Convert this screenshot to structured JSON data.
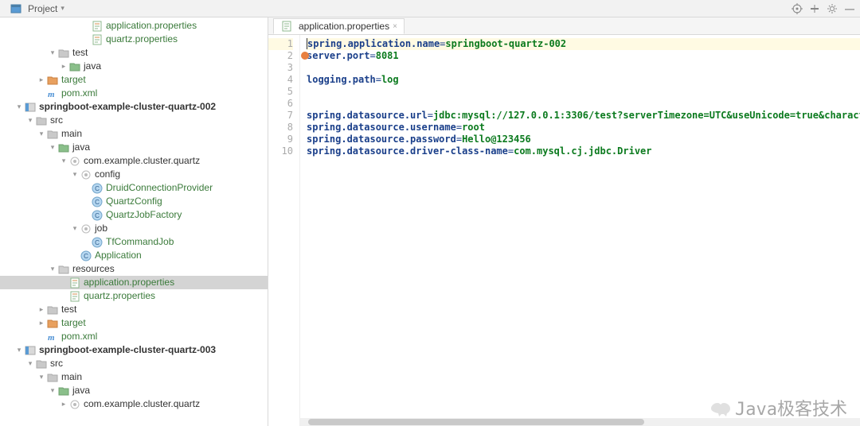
{
  "header": {
    "project_label": "Project",
    "dropdown_glyph": "▾"
  },
  "icons": {
    "target": "target-icon",
    "settings": "gear-icon",
    "collapse": "collapse-icon",
    "minimize": "—"
  },
  "tab": {
    "file_name": "application.properties",
    "close_glyph": "×"
  },
  "gutter": [
    "1",
    "2",
    "3",
    "4",
    "5",
    "6",
    "7",
    "8",
    "9",
    "10"
  ],
  "code": {
    "l1_k": "spring.application.name",
    "l1_v": "springboot-quartz-002",
    "l2_k": "server.port",
    "l2_v": "8081",
    "l4_k": "logging.path",
    "l4_v": "log",
    "l7_k": "spring.datasource.url",
    "l7_v": "jdbc:mysql://127.0.0.1:3306/test?serverTimezone=UTC&useUnicode=true&characte",
    "l8_k": "spring.datasource.username",
    "l8_v": "root",
    "l9_k": "spring.datasource.password",
    "l9_v": "Hello@123456",
    "l10_k": "spring.datasource.driver-class-name",
    "l10_v": "com.mysql.cj.jdbc.Driver"
  },
  "tree": [
    {
      "indent": 7,
      "arrow": "",
      "icon": "props",
      "label": "application.properties",
      "link": true
    },
    {
      "indent": 7,
      "arrow": "",
      "icon": "props",
      "label": "quartz.properties",
      "link": true
    },
    {
      "indent": 4,
      "arrow": "▾",
      "icon": "folder",
      "label": "test"
    },
    {
      "indent": 5,
      "arrow": "▸",
      "icon": "folder-src",
      "label": "java"
    },
    {
      "indent": 3,
      "arrow": "▸",
      "icon": "folder-orange",
      "label": "target",
      "link": true
    },
    {
      "indent": 3,
      "arrow": "",
      "icon": "maven",
      "label": "pom.xml",
      "link": true
    },
    {
      "indent": 1,
      "arrow": "▾",
      "icon": "module",
      "label": "springboot-example-cluster-quartz-002",
      "bold": true
    },
    {
      "indent": 2,
      "arrow": "▾",
      "icon": "folder",
      "label": "src"
    },
    {
      "indent": 3,
      "arrow": "▾",
      "icon": "folder",
      "label": "main"
    },
    {
      "indent": 4,
      "arrow": "▾",
      "icon": "folder-src",
      "label": "java"
    },
    {
      "indent": 5,
      "arrow": "▾",
      "icon": "package",
      "label": "com.example.cluster.quartz"
    },
    {
      "indent": 6,
      "arrow": "▾",
      "icon": "package",
      "label": "config"
    },
    {
      "indent": 7,
      "arrow": "",
      "icon": "class",
      "label": "DruidConnectionProvider",
      "link": true
    },
    {
      "indent": 7,
      "arrow": "",
      "icon": "class",
      "label": "QuartzConfig",
      "link": true
    },
    {
      "indent": 7,
      "arrow": "",
      "icon": "class",
      "label": "QuartzJobFactory",
      "link": true
    },
    {
      "indent": 6,
      "arrow": "▾",
      "icon": "package",
      "label": "job"
    },
    {
      "indent": 7,
      "arrow": "",
      "icon": "class",
      "label": "TfCommandJob",
      "link": true
    },
    {
      "indent": 6,
      "arrow": "",
      "icon": "class",
      "label": "Application",
      "link": true
    },
    {
      "indent": 4,
      "arrow": "▾",
      "icon": "folder-res",
      "label": "resources"
    },
    {
      "indent": 5,
      "arrow": "",
      "icon": "props",
      "label": "application.properties",
      "link": true,
      "selected": true
    },
    {
      "indent": 5,
      "arrow": "",
      "icon": "props",
      "label": "quartz.properties",
      "link": true
    },
    {
      "indent": 3,
      "arrow": "▸",
      "icon": "folder",
      "label": "test"
    },
    {
      "indent": 3,
      "arrow": "▸",
      "icon": "folder-orange",
      "label": "target",
      "link": true
    },
    {
      "indent": 3,
      "arrow": "",
      "icon": "maven",
      "label": "pom.xml",
      "link": true
    },
    {
      "indent": 1,
      "arrow": "▾",
      "icon": "module",
      "label": "springboot-example-cluster-quartz-003",
      "bold": true
    },
    {
      "indent": 2,
      "arrow": "▾",
      "icon": "folder",
      "label": "src"
    },
    {
      "indent": 3,
      "arrow": "▾",
      "icon": "folder",
      "label": "main"
    },
    {
      "indent": 4,
      "arrow": "▾",
      "icon": "folder-src",
      "label": "java"
    },
    {
      "indent": 5,
      "arrow": "▸",
      "icon": "package",
      "label": "com.example.cluster.quartz"
    }
  ],
  "watermark": "Java极客技术"
}
